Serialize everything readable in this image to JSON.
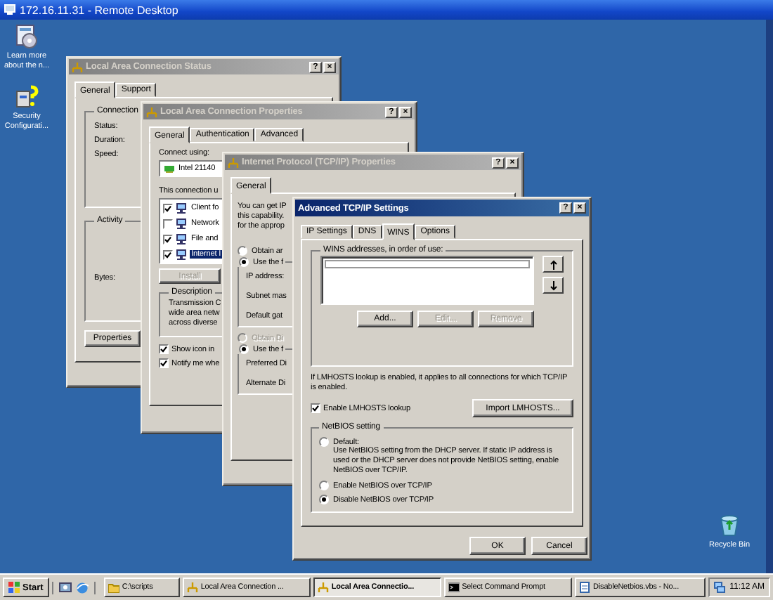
{
  "remote_desktop": {
    "title": "172.16.11.31 - Remote Desktop"
  },
  "desktop_icons": [
    {
      "kind": "help",
      "label": "Learn more about the n..."
    },
    {
      "kind": "security",
      "label": "Security Configurati..."
    },
    {
      "kind": "recycle",
      "label": "Recycle Bin"
    }
  ],
  "windows": [
    {
      "kind": "status",
      "title": "Local Area Connection Status",
      "active": false,
      "title_buttons": [
        "?",
        "×"
      ],
      "tabs": [
        {
          "label": "General",
          "selected": true
        },
        {
          "label": "Support",
          "selected": false
        }
      ],
      "groups": [
        {
          "label": "Connection",
          "fields": [
            "Status:",
            "Duration:",
            "Speed:"
          ]
        },
        {
          "label": "Activity",
          "fields": [
            "Bytes:"
          ]
        }
      ],
      "buttons": [
        {
          "label": "Properties",
          "disabled": false
        }
      ]
    },
    {
      "kind": "properties",
      "title": "Local Area Connection Properties",
      "active": false,
      "title_buttons": [
        "?",
        "×"
      ],
      "tabs": [
        {
          "label": "General",
          "selected": true
        },
        {
          "label": "Authentication",
          "selected": false
        },
        {
          "label": "Advanced",
          "selected": false
        }
      ],
      "connect_using": "Connect using:",
      "adapter": "Intel 21140",
      "components_label": "This connection u",
      "components": [
        {
          "label": "Client fo",
          "checked": true,
          "selected": false
        },
        {
          "label": "Network",
          "checked": false,
          "selected": false
        },
        {
          "label": "File and",
          "checked": true,
          "selected": false
        },
        {
          "label": "Internet I",
          "checked": true,
          "selected": true
        }
      ],
      "install_button": {
        "label": "Install",
        "disabled": true
      },
      "description": {
        "label": "Description",
        "lines": [
          "Transmission C",
          "wide area netw",
          "across diverse"
        ]
      },
      "options": [
        {
          "label": "Show icon in",
          "checked": true
        },
        {
          "label": "Notify me whe",
          "checked": true
        }
      ]
    },
    {
      "kind": "tcpip",
      "title": "Internet Protocol (TCP/IP) Properties",
      "active": false,
      "title_buttons": [
        "?",
        "×"
      ],
      "tabs": [
        {
          "label": "General",
          "selected": true
        }
      ],
      "intro": [
        "You can get IP",
        "this capability.",
        "for the approp"
      ],
      "sections": [
        {
          "radios": [
            {
              "label": "Obtain ar",
              "selected": false,
              "disabled": false
            },
            {
              "label": "Use the f",
              "selected": true,
              "disabled": false
            }
          ],
          "fields": [
            "IP address:",
            "Subnet mas",
            "Default gat"
          ]
        },
        {
          "radios": [
            {
              "label": "Obtain Di",
              "selected": false,
              "disabled": true
            },
            {
              "label": "Use the f",
              "selected": true,
              "disabled": false
            }
          ],
          "fields": [
            "Preferred Di",
            "Alternate Di"
          ]
        }
      ]
    },
    {
      "kind": "advanced",
      "title": "Advanced TCP/IP Settings",
      "active": true,
      "title_buttons": [
        "?",
        "×"
      ],
      "tabs": [
        {
          "label": "IP Settings",
          "selected": false
        },
        {
          "label": "DNS",
          "selected": false
        },
        {
          "label": "WINS",
          "selected": true
        },
        {
          "label": "Options",
          "selected": false
        }
      ],
      "wins_label": "WINS addresses, in order of use:",
      "list_buttons": [
        {
          "label": "Add...",
          "disabled": false
        },
        {
          "label": "Edit...",
          "disabled": true
        },
        {
          "label": "Remove",
          "disabled": true
        }
      ],
      "lmhosts_note": "If LMHOSTS lookup is enabled, it applies to all connections for which TCP/IP is enabled.",
      "lmhosts_lookup": {
        "label": "Enable LMHOSTS lookup",
        "checked": true
      },
      "import_button": "Import LMHOSTS...",
      "netbios": {
        "label": "NetBIOS setting",
        "options": [
          {
            "label": "Default:",
            "selected": false,
            "note": "Use NetBIOS setting from the DHCP server. If static IP address is used or the DHCP server does not provide NetBIOS setting, enable NetBIOS over TCP/IP."
          },
          {
            "label": "Enable NetBIOS over TCP/IP",
            "selected": false
          },
          {
            "label": "Disable NetBIOS over TCP/IP",
            "selected": true
          }
        ]
      },
      "buttons": [
        {
          "label": "OK"
        },
        {
          "label": "Cancel"
        }
      ]
    }
  ],
  "taskbar": {
    "start": "Start",
    "buttons": [
      {
        "kind": "folder",
        "label": "C:\\scripts",
        "selected": false
      },
      {
        "kind": "network",
        "label": "Local Area Connection ...",
        "selected": false
      },
      {
        "kind": "network",
        "label": "Local Area Connectio...",
        "selected": true
      },
      {
        "kind": "console",
        "label": "Select Command Prompt",
        "selected": false
      },
      {
        "kind": "notepad",
        "label": "DisableNetbios.vbs - No...",
        "selected": false
      }
    ],
    "clock": "11:12 AM"
  }
}
